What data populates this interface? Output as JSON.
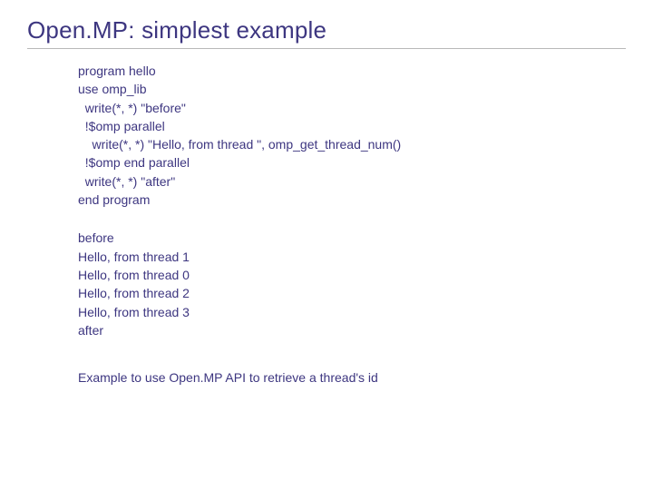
{
  "title": "Open.MP: simplest example",
  "code": {
    "l0": "program hello",
    "l1": "use omp_lib",
    "l2": "  write(*, *) \"before\"",
    "l3": "  !$omp parallel",
    "l4": "    write(*, *) \"Hello, from thread \", omp_get_thread_num()",
    "l5": "  !$omp end parallel",
    "l6": "  write(*, *) \"after\"",
    "l7": "end program"
  },
  "output": {
    "l0": "before",
    "l1": "Hello, from thread  1",
    "l2": "Hello, from thread  0",
    "l3": "Hello, from thread  2",
    "l4": "Hello, from thread  3",
    "l5": "after"
  },
  "caption": "Example to use Open.MP API to retrieve a thread's id"
}
